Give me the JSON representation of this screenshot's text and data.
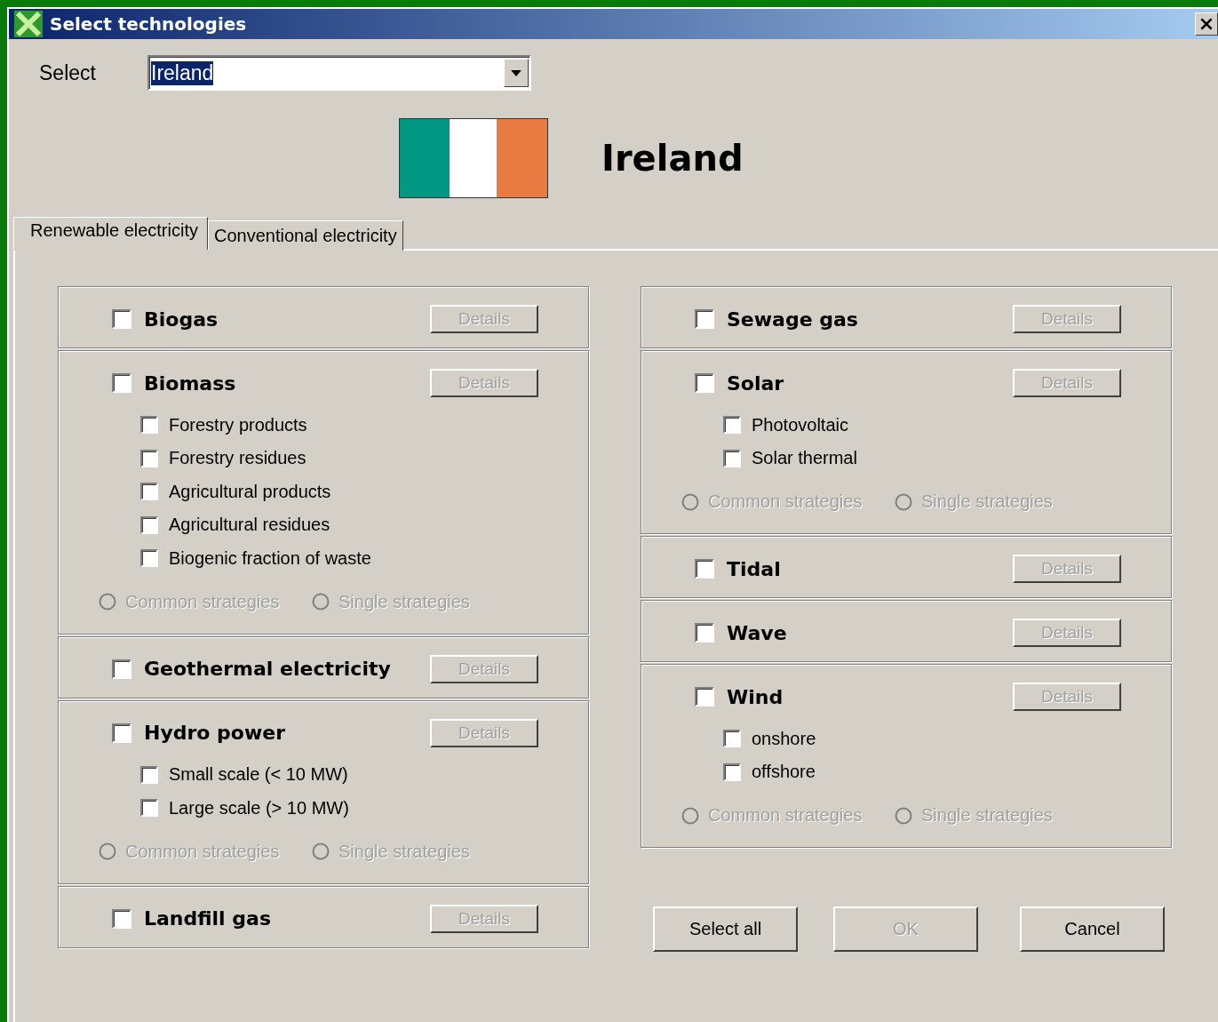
{
  "window": {
    "title": "Select technologies"
  },
  "select": {
    "label": "Select",
    "value": "Ireland"
  },
  "country": {
    "name": "Ireland"
  },
  "tabs": [
    {
      "label": "Renewable electricity",
      "selected": true
    },
    {
      "label": "Conventional electricity",
      "selected": false
    }
  ],
  "columns": [
    {
      "groups": [
        {
          "name": "Biogas",
          "checked": false,
          "details": {
            "label": "Details",
            "disabled": true
          }
        },
        {
          "name": "Biomass",
          "checked": false,
          "details": {
            "label": "Details",
            "disabled": true
          },
          "options": [
            {
              "label": "Forestry products",
              "checked": false
            },
            {
              "label": "Forestry residues",
              "checked": false
            },
            {
              "label": "Agricultural products",
              "checked": false
            },
            {
              "label": "Agricultural residues",
              "checked": false
            },
            {
              "label": "Biogenic fraction of waste",
              "checked": false
            }
          ],
          "strategies": [
            {
              "label": "Common strategies",
              "selected": false,
              "disabled": true
            },
            {
              "label": "Single strategies",
              "selected": false,
              "disabled": true
            }
          ]
        },
        {
          "name": "Geothermal electricity",
          "checked": false,
          "details": {
            "label": "Details",
            "disabled": true
          }
        },
        {
          "name": "Hydro power",
          "checked": false,
          "details": {
            "label": "Details",
            "disabled": true
          },
          "options": [
            {
              "label": "Small scale (< 10 MW)",
              "checked": false
            },
            {
              "label": "Large scale (> 10 MW)",
              "checked": false
            }
          ],
          "strategies": [
            {
              "label": "Common strategies",
              "selected": false,
              "disabled": true
            },
            {
              "label": "Single strategies",
              "selected": false,
              "disabled": true
            }
          ]
        },
        {
          "name": "Landfill gas",
          "checked": false,
          "details": {
            "label": "Details",
            "disabled": true
          }
        }
      ]
    },
    {
      "groups": [
        {
          "name": "Sewage gas",
          "checked": false,
          "details": {
            "label": "Details",
            "disabled": true
          }
        },
        {
          "name": "Solar",
          "checked": false,
          "details": {
            "label": "Details",
            "disabled": true
          },
          "options": [
            {
              "label": "Photovoltaic",
              "checked": false
            },
            {
              "label": "Solar thermal",
              "checked": false
            }
          ],
          "strategies": [
            {
              "label": "Common strategies",
              "selected": false,
              "disabled": true
            },
            {
              "label": "Single strategies",
              "selected": false,
              "disabled": true
            }
          ]
        },
        {
          "name": "Tidal",
          "checked": false,
          "details": {
            "label": "Details",
            "disabled": true
          }
        },
        {
          "name": "Wave",
          "checked": false,
          "details": {
            "label": "Details",
            "disabled": true
          }
        },
        {
          "name": "Wind",
          "checked": false,
          "details": {
            "label": "Details",
            "disabled": true
          },
          "options": [
            {
              "label": "onshore",
              "checked": false
            },
            {
              "label": "offshore",
              "checked": false
            }
          ],
          "strategies": [
            {
              "label": "Common strategies",
              "selected": false,
              "disabled": true
            },
            {
              "label": "Single strategies",
              "selected": false,
              "disabled": true
            }
          ]
        }
      ]
    }
  ],
  "buttons": [
    {
      "label": "Select all",
      "disabled": false
    },
    {
      "label": "OK",
      "disabled": true
    },
    {
      "label": "Cancel",
      "disabled": false
    }
  ]
}
